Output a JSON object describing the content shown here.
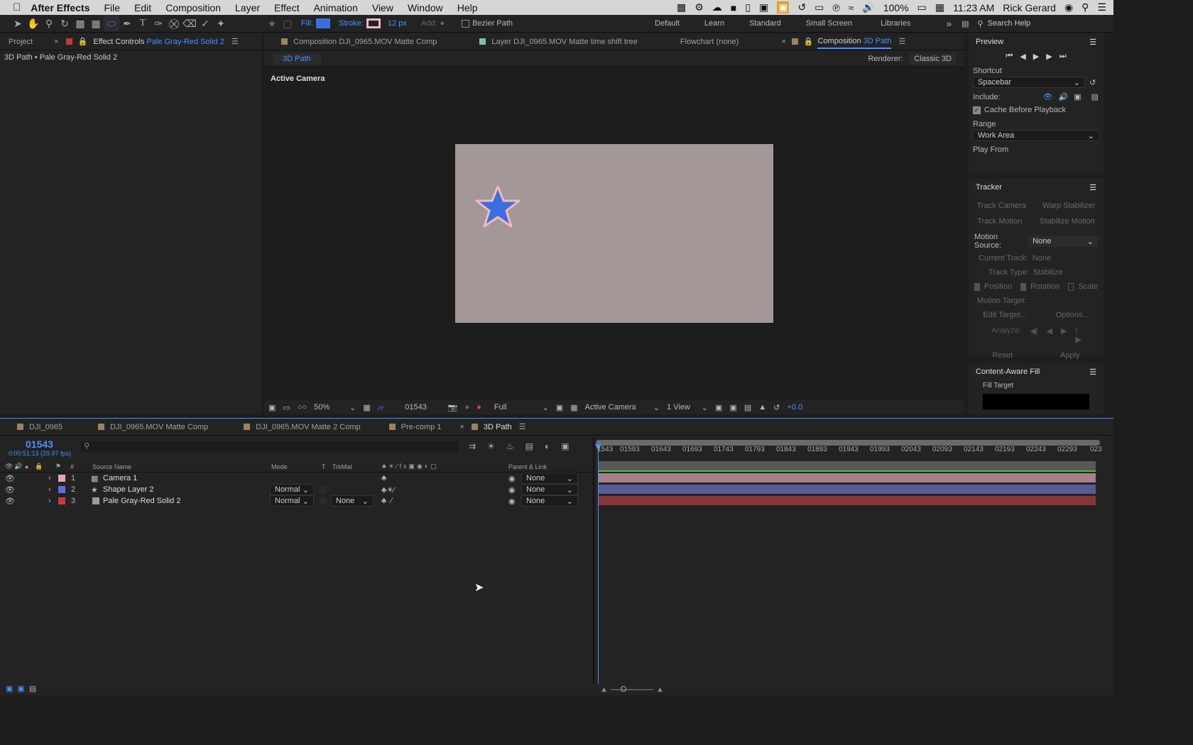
{
  "menubar": {
    "app": "After Effects",
    "items": [
      "File",
      "Edit",
      "Composition",
      "Layer",
      "Effect",
      "Animation",
      "View",
      "Window",
      "Help"
    ],
    "battery": "100%",
    "time": "11:23 AM",
    "user": "Rick Gerard"
  },
  "toolbar": {
    "fill_label": "Fill:",
    "stroke_label": "Stroke:",
    "stroke_px": "12 px",
    "add_label": "Add:",
    "bezier_label": "Bezier Path",
    "workspaces": [
      "Default",
      "Learn",
      "Standard",
      "Small Screen",
      "Libraries"
    ],
    "search_placeholder": "Search Help"
  },
  "left_panel": {
    "tab_project": "Project",
    "tab_effect": "Effect Controls",
    "tab_effect_layer": "Pale Gray-Red Solid 2",
    "path": "3D Path • Pale Gray-Red Solid 2"
  },
  "viewer": {
    "tabs": [
      "Composition DJI_0965.MOV Matte Comp",
      "Layer DJI_0965.MOV Matte time shift tree",
      "Flowchart (none)"
    ],
    "active_tab_prefix": "Composition",
    "active_tab": "3D Path",
    "sub_tab": "3D Path",
    "renderer_label": "Renderer:",
    "renderer": "Classic 3D",
    "camera_label": "Active Camera",
    "zoom": "50%",
    "frame": "01543",
    "resolution": "Full",
    "view": "Active Camera",
    "views": "1 View",
    "exposure": "+0.0"
  },
  "preview": {
    "title": "Preview",
    "shortcut_label": "Shortcut",
    "shortcut": "Spacebar",
    "include_label": "Include:",
    "cache_label": "Cache Before Playback",
    "range_label": "Range",
    "range": "Work Area",
    "play_from_label": "Play From"
  },
  "tracker": {
    "title": "Tracker",
    "track_camera": "Track Camera",
    "warp_stabilizer": "Warp Stabilizer",
    "track_motion": "Track Motion",
    "stabilize_motion": "Stabilize Motion",
    "motion_source_label": "Motion Source:",
    "motion_source": "None",
    "current_track_label": "Current Track:",
    "current_track": "None",
    "track_type_label": "Track Type:",
    "track_type": "Stabilize",
    "position": "Position",
    "rotation": "Rotation",
    "scale": "Scale",
    "motion_target": "Motion Target:",
    "edit_target": "Edit Target...",
    "options": "Options...",
    "analyze": "Analyze:",
    "reset": "Reset",
    "apply": "Apply"
  },
  "caf": {
    "title": "Content-Aware Fill",
    "fill_target": "Fill Target"
  },
  "timeline": {
    "tabs": [
      "DJI_0965",
      "DJI_0965.MOV Matte Comp",
      "DJI_0965.MOV Matte 2 Comp",
      "Pre-comp 1",
      "3D Path"
    ],
    "timecode": "01543",
    "timecode_sub": "0:00:51:13 (29.97 fps)",
    "col_source": "Source Name",
    "col_mode": "Mode",
    "col_t": "T",
    "col_trkmat": "TrkMat",
    "col_parent": "Parent & Link",
    "ruler": [
      "1543",
      "01593",
      "01643",
      "01693",
      "01743",
      "01793",
      "01843",
      "01893",
      "01943",
      "01993",
      "02043",
      "02093",
      "02143",
      "02193",
      "02243",
      "02293",
      "023"
    ],
    "layers": [
      {
        "num": "1",
        "name": "Camera 1",
        "mode": "",
        "trkmat": "",
        "parent": "None",
        "color": "#e8a3b8",
        "bar": "#a57f8a"
      },
      {
        "num": "2",
        "name": "Shape Layer 2",
        "mode": "Normal",
        "trkmat": "",
        "parent": "None",
        "color": "#5b6fd8",
        "bar": "#5a5a96"
      },
      {
        "num": "3",
        "name": "Pale Gray-Red Solid 2",
        "mode": "Normal",
        "trkmat": "None",
        "parent": "None",
        "color": "#c83a3a",
        "bar": "#8a3535"
      }
    ]
  },
  "colors": {
    "accent": "#4a8eff",
    "fill": "#3b6fe0",
    "stroke": "#f4b8c0",
    "solid": "#a39797"
  }
}
